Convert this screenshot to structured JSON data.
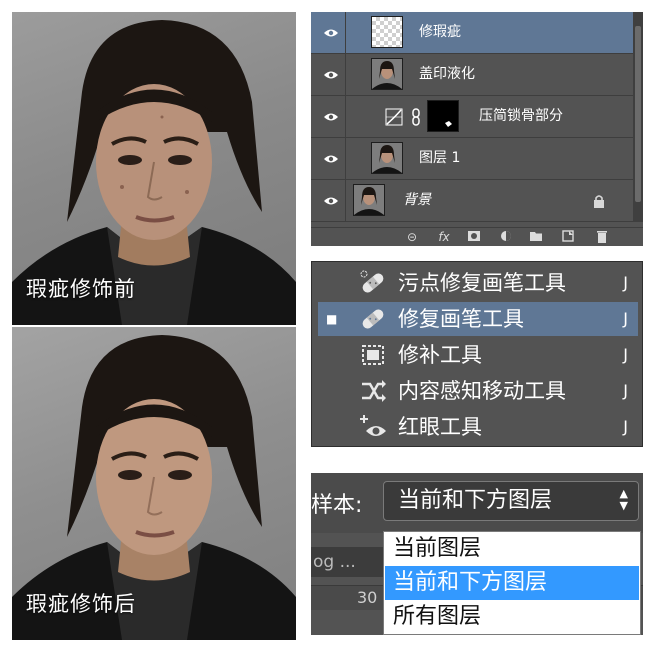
{
  "photos": {
    "before_caption": "瑕疵修饰前",
    "after_caption": "瑕疵修饰后"
  },
  "layers_panel": {
    "layers": [
      {
        "name": "修瑕疵",
        "selected": true,
        "thumbnail": "transparent"
      },
      {
        "name": "盖印液化",
        "selected": false,
        "thumbnail": "portrait"
      },
      {
        "name": "压简锁骨部分",
        "selected": false,
        "thumbnail": "mask",
        "adjustment_icon": "curves-adjustment-icon",
        "link_icon": "chain-link-icon"
      },
      {
        "name": "图层 1",
        "selected": false,
        "thumbnail": "portrait"
      },
      {
        "name": "背景",
        "selected": false,
        "thumbnail": "portrait",
        "locked": true
      }
    ],
    "toolbar_icons": [
      "link-layers-icon",
      "fx-icon",
      "add-mask-icon",
      "adjustment-layer-icon",
      "new-group-icon",
      "new-layer-icon",
      "delete-layer-icon"
    ],
    "toolbar_fx_label": "fx"
  },
  "tools_menu": {
    "items": [
      {
        "label": "污点修复画笔工具",
        "shortcut": "J",
        "icon": "spot-healing-brush-icon",
        "current": false
      },
      {
        "label": "修复画笔工具",
        "shortcut": "J",
        "icon": "healing-brush-icon",
        "current": true,
        "mark": "■"
      },
      {
        "label": "修补工具",
        "shortcut": "J",
        "icon": "patch-tool-icon",
        "current": false
      },
      {
        "label": "内容感知移动工具",
        "shortcut": "J",
        "icon": "content-aware-move-icon",
        "current": false
      },
      {
        "label": "红眼工具",
        "shortcut": "J",
        "icon": "red-eye-tool-icon",
        "current": false
      }
    ]
  },
  "sample": {
    "label": "样本:",
    "selected": "当前和下方图层",
    "options": [
      "当前图层",
      "当前和下方图层",
      "所有图层"
    ],
    "highlighted_index": 1,
    "doc_tab": "og ...",
    "ruler_number": "30"
  },
  "colors": {
    "panel_bg": "#535353",
    "selection_blue": "#5f7795",
    "dropdown_highlight": "#3399ff"
  }
}
